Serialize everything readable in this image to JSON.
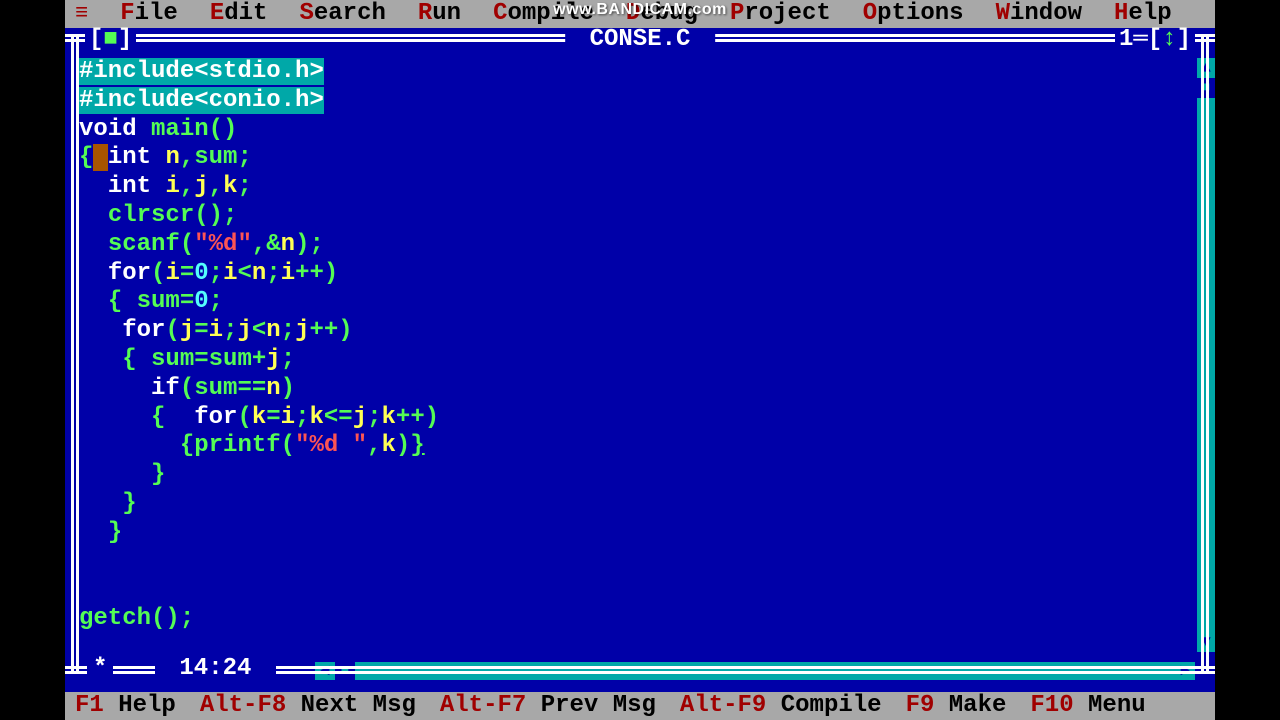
{
  "watermark": "www.BANDICAM.com",
  "menu": {
    "items": [
      {
        "hot": "F",
        "rest": "ile"
      },
      {
        "hot": "E",
        "rest": "dit"
      },
      {
        "hot": "S",
        "rest": "earch"
      },
      {
        "hot": "R",
        "rest": "un"
      },
      {
        "hot": "C",
        "rest": "ompile"
      },
      {
        "hot": "D",
        "rest": "ebug"
      },
      {
        "hot": "P",
        "rest": "roject"
      },
      {
        "hot": "O",
        "rest": "ptions"
      },
      {
        "hot": "W",
        "rest": "indow"
      },
      {
        "hot": "H",
        "rest": "elp"
      }
    ]
  },
  "window": {
    "title": "CONSE.C",
    "number": "1",
    "cursor_pos": "14:24",
    "modified_marker": "*"
  },
  "code_lines": [
    [
      {
        "cls": "hl",
        "t": "#include<stdio.h>"
      }
    ],
    [
      {
        "cls": "hl",
        "t": "#include<conio.h>"
      }
    ],
    [
      {
        "cls": "kw",
        "t": "void"
      },
      {
        "cls": "",
        "t": " "
      },
      {
        "cls": "fn",
        "t": "main"
      },
      {
        "cls": "sym",
        "t": "()"
      }
    ],
    [
      {
        "cls": "brace",
        "t": "{"
      },
      {
        "cls": "cursor-mark",
        "t": " "
      },
      {
        "cls": "kw",
        "t": "int"
      },
      {
        "cls": "",
        "t": " "
      },
      {
        "cls": "id",
        "t": "n"
      },
      {
        "cls": "sym",
        "t": ","
      },
      {
        "cls": "fn",
        "t": "sum"
      },
      {
        "cls": "sym",
        "t": ";"
      }
    ],
    [
      {
        "cls": "",
        "t": "  "
      },
      {
        "cls": "kw",
        "t": "int"
      },
      {
        "cls": "",
        "t": " "
      },
      {
        "cls": "id",
        "t": "i"
      },
      {
        "cls": "sym",
        "t": ","
      },
      {
        "cls": "id",
        "t": "j"
      },
      {
        "cls": "sym",
        "t": ","
      },
      {
        "cls": "id",
        "t": "k"
      },
      {
        "cls": "sym",
        "t": ";"
      }
    ],
    [
      {
        "cls": "",
        "t": "  "
      },
      {
        "cls": "fn",
        "t": "clrscr"
      },
      {
        "cls": "sym",
        "t": "();"
      }
    ],
    [
      {
        "cls": "",
        "t": "  "
      },
      {
        "cls": "fn",
        "t": "scanf"
      },
      {
        "cls": "sym",
        "t": "("
      },
      {
        "cls": "str",
        "t": "\"%d\""
      },
      {
        "cls": "sym",
        "t": ",&"
      },
      {
        "cls": "id",
        "t": "n"
      },
      {
        "cls": "sym",
        "t": ");"
      }
    ],
    [
      {
        "cls": "",
        "t": "  "
      },
      {
        "cls": "kw",
        "t": "for"
      },
      {
        "cls": "sym",
        "t": "("
      },
      {
        "cls": "id",
        "t": "i"
      },
      {
        "cls": "sym",
        "t": "="
      },
      {
        "cls": "num",
        "t": "0"
      },
      {
        "cls": "sym",
        "t": ";"
      },
      {
        "cls": "id",
        "t": "i"
      },
      {
        "cls": "sym",
        "t": "<"
      },
      {
        "cls": "id",
        "t": "n"
      },
      {
        "cls": "sym",
        "t": ";"
      },
      {
        "cls": "id",
        "t": "i"
      },
      {
        "cls": "sym",
        "t": "++)"
      }
    ],
    [
      {
        "cls": "",
        "t": "  "
      },
      {
        "cls": "brace",
        "t": "{"
      },
      {
        "cls": "",
        "t": " "
      },
      {
        "cls": "fn",
        "t": "sum"
      },
      {
        "cls": "sym",
        "t": "="
      },
      {
        "cls": "num",
        "t": "0"
      },
      {
        "cls": "sym",
        "t": ";"
      }
    ],
    [
      {
        "cls": "",
        "t": "   "
      },
      {
        "cls": "kw",
        "t": "for"
      },
      {
        "cls": "sym",
        "t": "("
      },
      {
        "cls": "id",
        "t": "j"
      },
      {
        "cls": "sym",
        "t": "="
      },
      {
        "cls": "id",
        "t": "i"
      },
      {
        "cls": "sym",
        "t": ";"
      },
      {
        "cls": "id",
        "t": "j"
      },
      {
        "cls": "sym",
        "t": "<"
      },
      {
        "cls": "id",
        "t": "n"
      },
      {
        "cls": "sym",
        "t": ";"
      },
      {
        "cls": "id",
        "t": "j"
      },
      {
        "cls": "sym",
        "t": "++)"
      }
    ],
    [
      {
        "cls": "",
        "t": "   "
      },
      {
        "cls": "brace",
        "t": "{"
      },
      {
        "cls": "",
        "t": " "
      },
      {
        "cls": "fn",
        "t": "sum"
      },
      {
        "cls": "sym",
        "t": "="
      },
      {
        "cls": "fn",
        "t": "sum"
      },
      {
        "cls": "sym",
        "t": "+"
      },
      {
        "cls": "id",
        "t": "j"
      },
      {
        "cls": "sym",
        "t": ";"
      }
    ],
    [
      {
        "cls": "",
        "t": "     "
      },
      {
        "cls": "kw",
        "t": "if"
      },
      {
        "cls": "sym",
        "t": "("
      },
      {
        "cls": "fn",
        "t": "sum"
      },
      {
        "cls": "sym",
        "t": "=="
      },
      {
        "cls": "id",
        "t": "n"
      },
      {
        "cls": "sym",
        "t": ")"
      }
    ],
    [
      {
        "cls": "",
        "t": "     "
      },
      {
        "cls": "brace",
        "t": "{"
      },
      {
        "cls": "",
        "t": "  "
      },
      {
        "cls": "kw",
        "t": "for"
      },
      {
        "cls": "sym",
        "t": "("
      },
      {
        "cls": "id",
        "t": "k"
      },
      {
        "cls": "sym",
        "t": "="
      },
      {
        "cls": "id",
        "t": "i"
      },
      {
        "cls": "sym",
        "t": ";"
      },
      {
        "cls": "id",
        "t": "k"
      },
      {
        "cls": "sym",
        "t": "<="
      },
      {
        "cls": "id",
        "t": "j"
      },
      {
        "cls": "sym",
        "t": ";"
      },
      {
        "cls": "id",
        "t": "k"
      },
      {
        "cls": "sym",
        "t": "++)"
      }
    ],
    [
      {
        "cls": "",
        "t": "       "
      },
      {
        "cls": "brace",
        "t": "{"
      },
      {
        "cls": "fn",
        "t": "printf"
      },
      {
        "cls": "sym",
        "t": "("
      },
      {
        "cls": "str",
        "t": "\"%d \""
      },
      {
        "cls": "sym",
        "t": ","
      },
      {
        "cls": "id",
        "t": "k"
      },
      {
        "cls": "sym",
        "t": ")"
      },
      {
        "cls": "brace under",
        "t": "}"
      }
    ],
    [
      {
        "cls": "",
        "t": "     "
      },
      {
        "cls": "brace",
        "t": "}"
      }
    ],
    [
      {
        "cls": "",
        "t": "   "
      },
      {
        "cls": "brace",
        "t": "}"
      }
    ],
    [
      {
        "cls": "",
        "t": "  "
      },
      {
        "cls": "brace",
        "t": "}"
      }
    ],
    [
      {
        "cls": "",
        "t": ""
      }
    ],
    [
      {
        "cls": "",
        "t": ""
      }
    ],
    [
      {
        "cls": "fn",
        "t": "getch"
      },
      {
        "cls": "sym",
        "t": "();"
      }
    ]
  ],
  "status": {
    "items": [
      {
        "hot": "F1",
        "rest": " Help"
      },
      {
        "hot": "Alt-F8",
        "rest": " Next Msg"
      },
      {
        "hot": "Alt-F7",
        "rest": " Prev Msg"
      },
      {
        "hot": "Alt-F9",
        "rest": " Compile"
      },
      {
        "hot": "F9",
        "rest": " Make"
      },
      {
        "hot": "F10",
        "rest": " Menu"
      }
    ]
  }
}
